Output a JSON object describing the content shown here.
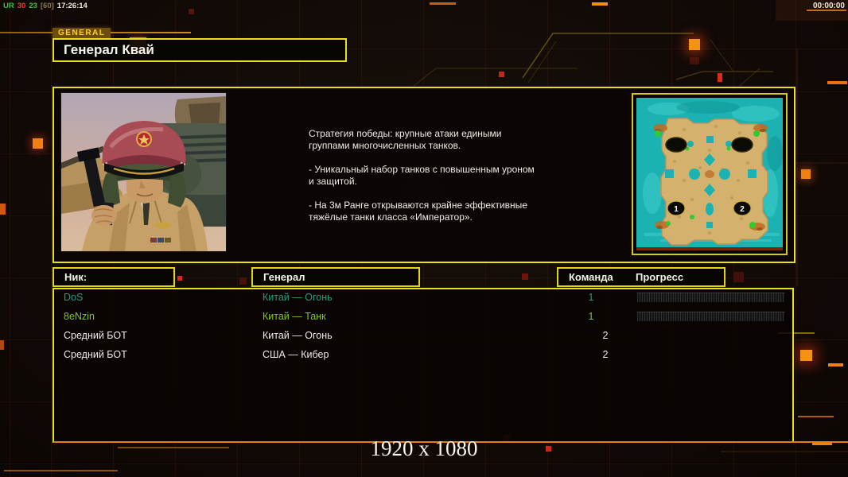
{
  "status_bar": {
    "tokens": [
      {
        "text": "UR",
        "color": "#3ec43e"
      },
      {
        "text": "30",
        "color": "#e04430"
      },
      {
        "text": "23",
        "color": "#3ec43e"
      },
      {
        "text": "[60]",
        "color": "#8a7a50"
      },
      {
        "text": "17:26:14",
        "color": "#f0ead8"
      }
    ],
    "timer": "00:00:00"
  },
  "header": {
    "tab_label": "GENERAL",
    "title": "Генерал Квай"
  },
  "info_panel": {
    "description": [
      "Стратегия победы: крупные атаки едиными\n группами многочисленных танков.",
      "- Уникальный набор танков с повышенным уроном\n и защитой.",
      "- На 3м Ранге открываются крайне эффективные\n тяжёлые танки класса «Император»."
    ],
    "map": {
      "markers": [
        "1",
        "2"
      ]
    }
  },
  "table": {
    "headers": {
      "nick": "Ник:",
      "general": "Генерал",
      "team": "Команда",
      "progress": "Прогресс"
    },
    "rows": [
      {
        "nick": "DoS",
        "general": "Китай — Огонь",
        "team": "1",
        "has_progress": true,
        "color": "#2e9a84"
      },
      {
        "nick": "8eNzin",
        "general": "Китай — Танк",
        "team": "1",
        "has_progress": true,
        "color": "#84c81e"
      },
      {
        "nick": "Средний БОТ",
        "general": "Китай — Огонь",
        "team": "2",
        "has_progress": false,
        "color": "#ededea"
      },
      {
        "nick": "Средний БОТ",
        "general": "США — Кибер",
        "team": "2",
        "has_progress": false,
        "color": "#ededea"
      }
    ]
  },
  "footer": {
    "resolution": "1920 x 1080"
  },
  "colors": {
    "panel_border": "#e8e019",
    "map_border": "#d8c70e",
    "accent_orange": "#e87d0e",
    "tab_bg": "#6b4d0c",
    "tab_text": "#ffd21c"
  }
}
